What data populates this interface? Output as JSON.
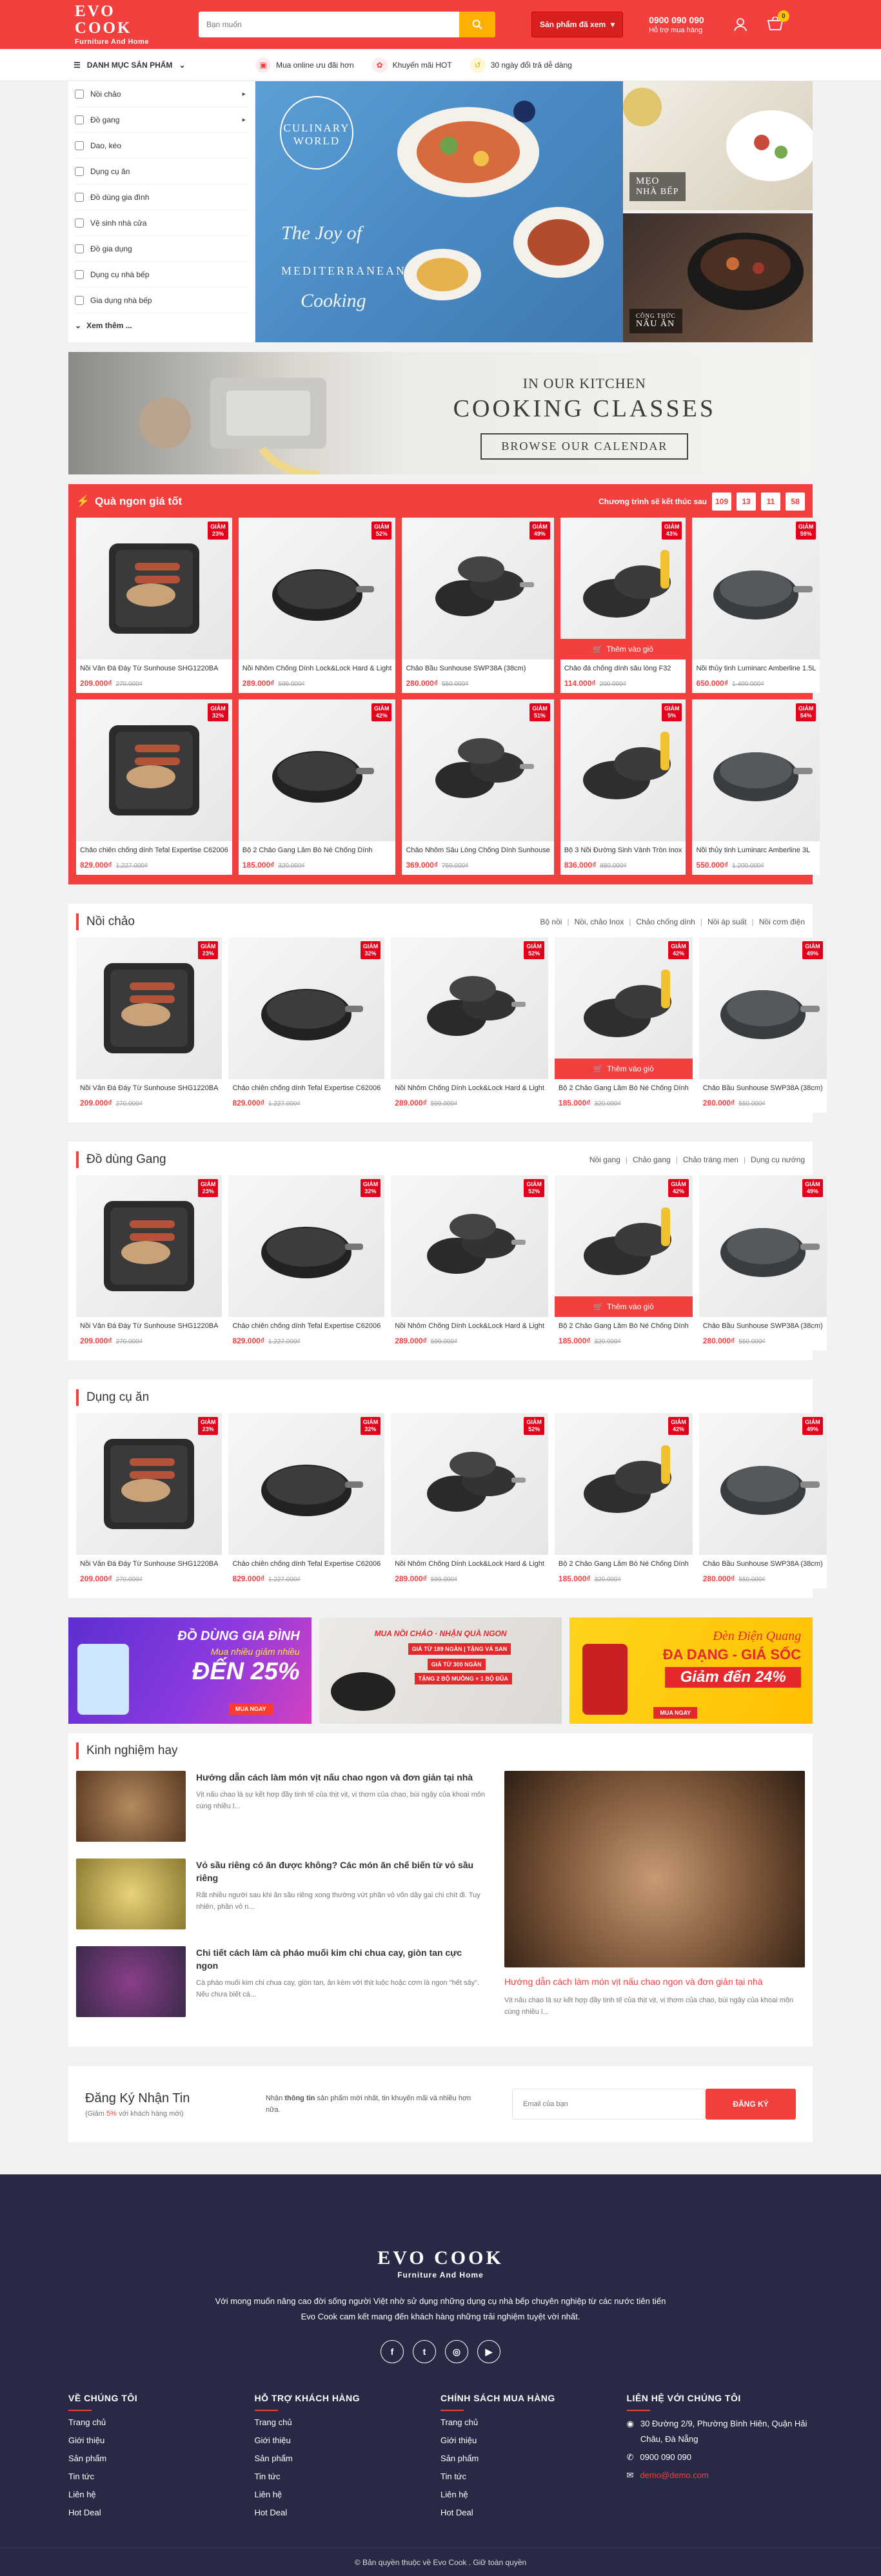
{
  "header": {
    "logo_title": "EVO COOK",
    "logo_sub": "Furniture And Home",
    "search_placeholder": "Bạn muốn",
    "seen_label": "Sản phẩm đã xem",
    "hotline": "0900 090 090",
    "hotline_sub": "Hỗ trợ mua hàng",
    "cart_count": "0"
  },
  "nav": {
    "category_title": "DANH MỤC SẢN PHẨM",
    "policies": [
      "Mua online ưu đãi hơn",
      "Khuyến mãi HOT",
      "30 ngày đổi trả dễ dàng"
    ]
  },
  "categories": [
    "Nồi chảo",
    "Đồ gang",
    "Dao, kéo",
    "Dụng cụ ăn",
    "Đồ dùng gia đình",
    "Vệ sinh nhà cửa",
    "Đồ gia dụng",
    "Dụng cụ nhà bếp",
    "Gia dụng nhà bếp"
  ],
  "categories_more": "Xem thêm ...",
  "hero": {
    "main_brand_1": "CULINARY",
    "main_brand_2": "WORLD",
    "main_script_1": "The Joy of",
    "main_script_2": "MEDITERRANEAN",
    "main_script_3": "Cooking",
    "side1_a": "MẸO",
    "side1_b": "NHÀ BẾP",
    "side2_a": "CÔNG THỨC",
    "side2_b": "NẤU ĂN"
  },
  "cook_banner": {
    "line1": "IN OUR KITCHEN",
    "line2": "COOKING CLASSES",
    "button": "BROWSE OUR CALENDAR"
  },
  "flash": {
    "title": "Quà ngon giá tốt",
    "countdown_label": "Chương trình sẽ kết thúc sau",
    "countdown": [
      "109",
      "13",
      "11",
      "58"
    ],
    "add_label": "Thêm vào giỏ",
    "products": [
      {
        "name": "Nồi Vân Đá Đáy Từ Sunhouse SHG1220BA",
        "price": "209.000₫",
        "old": "270.000₫",
        "discount": "23%"
      },
      {
        "name": "Nồi Nhôm Chống Dính Lock&Lock Hard & Light",
        "price": "289.000₫",
        "old": "599.000₫",
        "discount": "52%"
      },
      {
        "name": "Chảo Bầu Sunhouse SWP38A (38cm)",
        "price": "280.000₫",
        "old": "550.000₫",
        "discount": "49%"
      },
      {
        "name": "Chảo đá chống dính sâu lòng F32",
        "price": "114.000₫",
        "old": "200.000₫",
        "discount": "43%"
      },
      {
        "name": "Nồi thủy tinh Luminarc Amberline 1.5L",
        "price": "650.000₫",
        "old": "1.400.000₫",
        "discount": "59%"
      },
      {
        "name": "Chảo chiên chống dính Tefal Expertise C62006",
        "price": "829.000₫",
        "old": "1.227.000₫",
        "discount": "32%"
      },
      {
        "name": "Bộ 2 Chảo Gang Lâm Bò Né Chống Dính",
        "price": "185.000₫",
        "old": "320.000₫",
        "discount": "42%"
      },
      {
        "name": "Chảo Nhôm Sâu Lòng Chống Dính Sunhouse",
        "price": "369.000₫",
        "old": "759.000₫",
        "discount": "51%"
      },
      {
        "name": "Bộ 3 Nồi Đường Sinh Vành Tròn Inox",
        "price": "836.000₫",
        "old": "880.000₫",
        "discount": "5%"
      },
      {
        "name": "Nồi thủy tinh Luminarc Amberline 3L",
        "price": "550.000₫",
        "old": "1.200.000₫",
        "discount": "54%"
      }
    ]
  },
  "sections": [
    {
      "title": "Nồi chảo",
      "tags": [
        "Bộ nồi",
        "Nồi, chảo Inox",
        "Chảo chống dính",
        "Nồi áp suất",
        "Nồi cơm điện"
      ],
      "products": [
        {
          "name": "Nồi Vân Đá Đáy Từ Sunhouse SHG1220BA",
          "price": "209.000₫",
          "old": "270.000₫",
          "discount": "23%"
        },
        {
          "name": "Chảo chiên chống dính Tefal Expertise C62006",
          "price": "829.000₫",
          "old": "1.227.000₫",
          "discount": "32%"
        },
        {
          "name": "Nồi Nhôm Chống Dính Lock&Lock Hard & Light",
          "price": "289.000₫",
          "old": "599.000₫",
          "discount": "52%"
        },
        {
          "name": "Bộ 2 Chảo Gang Lâm Bò Né Chống Dính",
          "price": "185.000₫",
          "old": "320.000₫",
          "discount": "42%"
        },
        {
          "name": "Chảo Bầu Sunhouse SWP38A (38cm)",
          "price": "280.000₫",
          "old": "550.000₫",
          "discount": "49%"
        }
      ]
    },
    {
      "title": "Đồ dùng Gang",
      "tags": [
        "Nồi gang",
        "Chảo gang",
        "Chảo tráng men",
        "Dụng cụ nướng"
      ],
      "products": [
        {
          "name": "Nồi Vân Đá Đáy Từ Sunhouse SHG1220BA",
          "price": "209.000₫",
          "old": "270.000₫",
          "discount": "23%"
        },
        {
          "name": "Chảo chiên chống dính Tefal Expertise C62006",
          "price": "829.000₫",
          "old": "1.227.000₫",
          "discount": "32%"
        },
        {
          "name": "Nồi Nhôm Chống Dính Lock&Lock Hard & Light",
          "price": "289.000₫",
          "old": "599.000₫",
          "discount": "52%"
        },
        {
          "name": "Bộ 2 Chảo Gang Lâm Bò Né Chống Dính",
          "price": "185.000₫",
          "old": "320.000₫",
          "discount": "42%"
        },
        {
          "name": "Chảo Bầu Sunhouse SWP38A (38cm)",
          "price": "280.000₫",
          "old": "550.000₫",
          "discount": "49%"
        }
      ]
    },
    {
      "title": "Dụng cụ ăn",
      "tags": [],
      "products": [
        {
          "name": "Nồi Vân Đá Đáy Từ Sunhouse SHG1220BA",
          "price": "209.000₫",
          "old": "270.000₫",
          "discount": "23%"
        },
        {
          "name": "Chảo chiên chống dính Tefal Expertise C62006",
          "price": "829.000₫",
          "old": "1.227.000₫",
          "discount": "32%"
        },
        {
          "name": "Nồi Nhôm Chống Dính Lock&Lock Hard & Light",
          "price": "289.000₫",
          "old": "599.000₫",
          "discount": "52%"
        },
        {
          "name": "Bộ 2 Chảo Gang Lâm Bò Né Chống Dính",
          "price": "185.000₫",
          "old": "320.000₫",
          "discount": "42%"
        },
        {
          "name": "Chảo Bầu Sunhouse SWP38A (38cm)",
          "price": "280.000₫",
          "old": "550.000₫",
          "discount": "49%"
        }
      ]
    }
  ],
  "promos": {
    "p1_title": "ĐỒ DÙNG GIA ĐÌNH",
    "p1_sub": "Mua nhiều giảm nhiều",
    "p1_big": "ĐẾN 25%",
    "p1_btn": "MUA NGAY",
    "p2_title": "MUA NỒI CHẢO · NHẬN QUÀ NGON",
    "p2_line1": "GIÁ TỪ 189 NGÀN | TẶNG VÁ SAN",
    "p2_line2": "GIÁ TỪ 300 NGÀN",
    "p2_line3": "TẶNG 2 BỘ MUỖNG + 1 BỘ ĐŨA",
    "p3_title": "Đèn Điện Quang",
    "p3_sub": "ĐA DẠNG - GIÁ SỐC",
    "p3_big": "Giảm đến 24%",
    "p3_btn": "MUA NGAY"
  },
  "experience": {
    "title": "Kinh nghiệm hay",
    "articles": [
      {
        "title": "Hướng dẫn cách làm món vịt nấu chao ngon và đơn giản tại nhà",
        "desc": "Vịt nấu chao là sự kết hợp đầy tinh tế của thịt vịt, vị thơm của chao, bùi ngậy của khoai môn cùng nhiều l..."
      },
      {
        "title": "Vỏ sầu riêng có ăn được không? Các món ăn chế biến từ vỏ sầu riêng",
        "desc": "Rất nhiều người sau khi ăn sầu riêng xong thường vứt phần vỏ vốn dầy gai chi chít đi. Tuy nhiên, phần vỏ n..."
      },
      {
        "title": "Chi tiết cách làm cà pháo muối kim chi chua cay, giòn tan cực ngon",
        "desc": "Cà pháo muối kim chi chua cay, giòn tan, ăn kèm với thịt luộc hoặc cơm là ngon \"hết sảy\". Nếu chưa biết cá..."
      }
    ],
    "featured_title": "Hướng dẫn cách làm món vịt nấu chao ngon và đơn giản tại nhà",
    "featured_desc": "Vịt nấu chao là sự kết hợp đầy tinh tế của thịt vịt, vị thơm của chao, bùi ngậy của khoai môn cùng nhiều l..."
  },
  "newsletter": {
    "title": "Đăng Ký Nhận Tin",
    "sub_pre": "(Giảm ",
    "sub_pct": "5%",
    "sub_post": " với khách hàng mới)",
    "desc_pre": "Nhận ",
    "desc_bold": "thông tin",
    "desc_post": " sản phẩm mới nhất, tin khuyến mãi và nhiều hơn nữa.",
    "placeholder": "Email của bạn",
    "button": "ĐĂNG KÝ"
  },
  "footer": {
    "logo_title": "EVO COOK",
    "logo_sub": "Furniture And Home",
    "desc1": "Với mong muốn nâng cao đời sống người Việt nhờ sử dụng những dụng cụ nhà bếp chuyên nghiệp từ các nước tiên tiến",
    "desc2": "Evo Cook cam kết mang đến khách hàng những trải nghiệm tuyệt vời nhất.",
    "cols": [
      {
        "title": "VỀ CHÚNG TÔI",
        "links": [
          "Trang chủ",
          "Giới thiệu",
          "Sản phẩm",
          "Tin tức",
          "Liên hệ",
          "Hot Deal"
        ]
      },
      {
        "title": "HỖ TRỢ KHÁCH HÀNG",
        "links": [
          "Trang chủ",
          "Giới thiệu",
          "Sản phẩm",
          "Tin tức",
          "Liên hệ",
          "Hot Deal"
        ]
      },
      {
        "title": "CHÍNH SÁCH MUA HÀNG",
        "links": [
          "Trang chủ",
          "Giới thiệu",
          "Sản phẩm",
          "Tin tức",
          "Liên hệ",
          "Hot Deal"
        ]
      }
    ],
    "contact_title": "LIÊN HỆ VỚI CHÚNG TÔI",
    "address": "30 Đường 2/9, Phường Bình Hiên, Quận Hải Châu, Đà Nẵng",
    "phone": "0900 090 090",
    "email": "demo@demo.com",
    "copyright": "© Bản quyền thuộc về Evo Cook . Giữ toàn quyền"
  },
  "colors": {
    "accent": "#f43f3f",
    "footer_bg": "#2a2945",
    "search_btn": "#ffb000"
  }
}
